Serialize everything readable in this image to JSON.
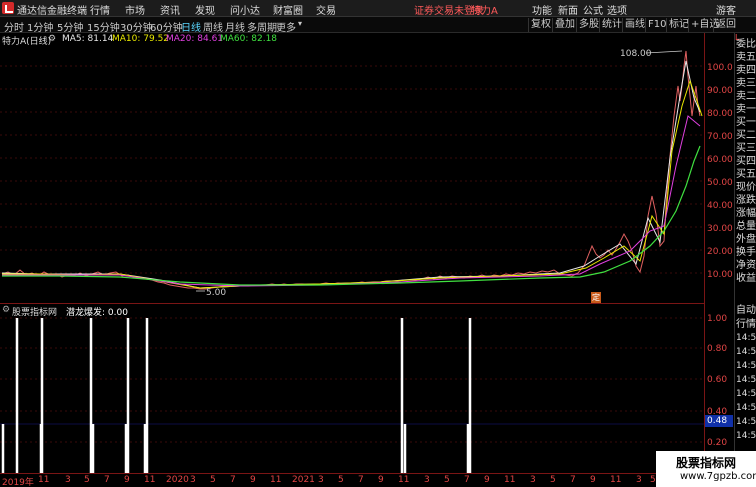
{
  "title_bar": {
    "app_title": "通达信金融终端",
    "menu": [
      "行情",
      "市场",
      "资讯",
      "发现",
      "问小达",
      "财富圈",
      "交易"
    ],
    "login_status": "证券交易未登录",
    "stock_title": "特力A",
    "right_menu": [
      "功能",
      "新面",
      "公式",
      "选项"
    ],
    "guest": "游客"
  },
  "toolbar": {
    "periods": [
      "分时",
      "1分钟",
      "5分钟",
      "15分钟",
      "30分钟",
      "60分钟",
      "日线",
      "周线",
      "月线",
      "多周期",
      "更多"
    ],
    "active_period": "日线",
    "tools": [
      "复权",
      "叠加",
      "多股",
      "统计",
      "画线",
      "F10",
      "标记",
      "+自选",
      "返回"
    ]
  },
  "ma_legend": {
    "stock": "特力A(日线)",
    "ma5": "MA5: 81.14",
    "ma10": "MA10: 79.52",
    "ma20": "MA20: 84.61",
    "ma60": "MA60: 82.18",
    "colors": {
      "ma5": "#e8e8e8",
      "ma10": "#e8e800",
      "ma20": "#e040e0",
      "ma60": "#40e040"
    }
  },
  "price_chart": {
    "high_label": "108.00",
    "low_label": "5.00",
    "marker": "定",
    "y_ticks": [
      "100.0",
      "90.00",
      "80.00",
      "70.00",
      "60.00",
      "50.00",
      "40.00",
      "30.00",
      "20.00",
      "10.00"
    ]
  },
  "indicator": {
    "name": "股票指标网",
    "formula": "潜龙爆发: 0.00",
    "current_value": "0.48",
    "y_ticks": [
      "1.00",
      "0.80",
      "0.60",
      "0.40",
      "0.20"
    ]
  },
  "side_panel": {
    "top": "L",
    "labels": [
      "委比",
      "卖五",
      "卖四",
      "卖三",
      "卖二",
      "卖一",
      "买一",
      "买二",
      "买三",
      "买四",
      "买五",
      "现价",
      "涨跌",
      "涨幅",
      "总量",
      "外盘",
      "换手",
      "净资",
      "收益"
    ],
    "auto_label": "自动",
    "market_label": "行情",
    "times": [
      "14:5",
      "14:5",
      "14:5",
      "14:5",
      "14:5",
      "14:5",
      "14:5",
      "14:5",
      "14:5",
      "14:5"
    ]
  },
  "date_axis": [
    "2019年",
    "11",
    "3",
    "5",
    "7",
    "9",
    "11",
    "2020",
    "3",
    "5",
    "7",
    "9",
    "11",
    "2021",
    "3",
    "5",
    "7",
    "9",
    "11",
    "3",
    "5",
    "7",
    "9",
    "11",
    "3",
    "5",
    "7",
    "9",
    "11",
    "3",
    "5",
    "7",
    "9"
  ],
  "watermark": {
    "title": "股票指标网",
    "url": "www.7gpzb.com"
  }
}
